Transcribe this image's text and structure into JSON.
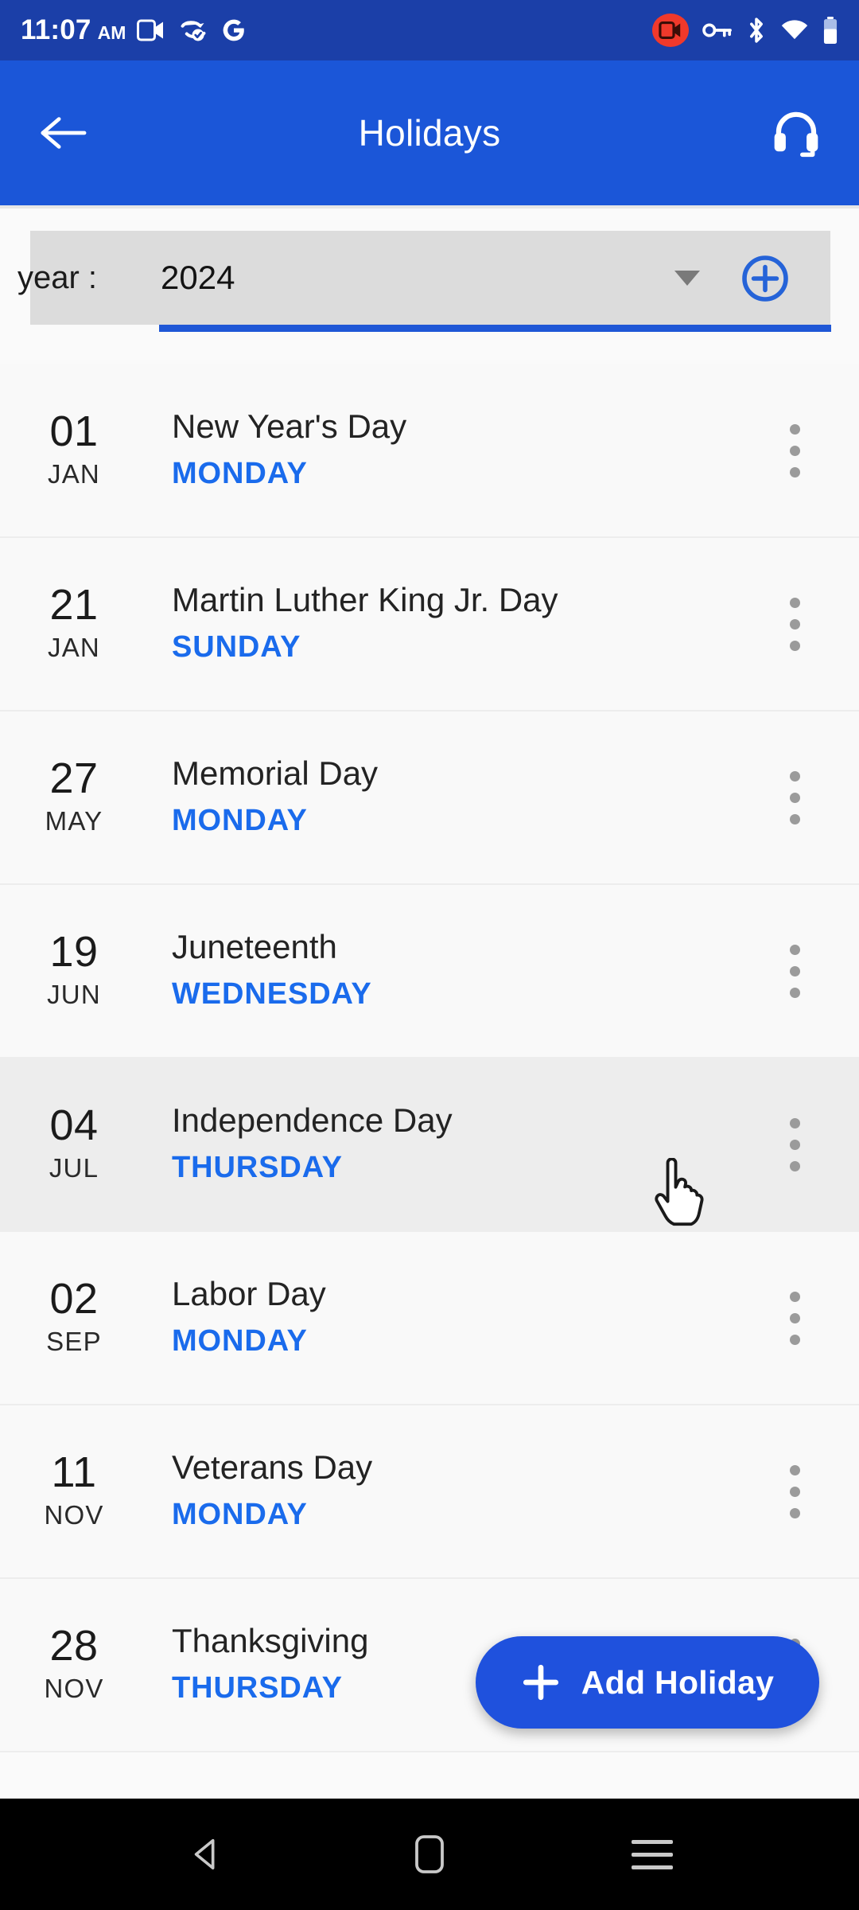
{
  "status_bar": {
    "time": "11:07",
    "ampm": "AM",
    "icons_left": [
      "video-camera-icon",
      "sync-check-icon",
      "google-g-icon"
    ],
    "icons_right": [
      "screen-record-icon",
      "vpn-key-icon",
      "bluetooth-icon",
      "wifi-icon",
      "battery-icon"
    ],
    "background_color": "#1b3fa8"
  },
  "app_bar": {
    "back_label": "back-arrow",
    "title": "Holidays",
    "support_label": "headset-support",
    "background_color": "#1b56d8"
  },
  "year_selector": {
    "label": "year :",
    "value": "2024",
    "caret": "chevron-down-icon",
    "add_label": "add-circle",
    "underline_color": "#1f57d6",
    "field_background": "#dcdcdc"
  },
  "list": {
    "weekday_color": "#1a6bec",
    "holidays": [
      {
        "day": "01",
        "month": "JAN",
        "name": "New Year's Day",
        "weekday": "MONDAY",
        "hovered": false
      },
      {
        "day": "21",
        "month": "JAN",
        "name": "Martin Luther King Jr. Day",
        "weekday": "SUNDAY",
        "hovered": false
      },
      {
        "day": "27",
        "month": "MAY",
        "name": "Memorial Day",
        "weekday": "MONDAY",
        "hovered": false
      },
      {
        "day": "19",
        "month": "JUN",
        "name": "Juneteenth",
        "weekday": "WEDNESDAY",
        "hovered": false
      },
      {
        "day": "04",
        "month": "JUL",
        "name": "Independence Day",
        "weekday": "THURSDAY",
        "hovered": true
      },
      {
        "day": "02",
        "month": "SEP",
        "name": "Labor Day",
        "weekday": "MONDAY",
        "hovered": false
      },
      {
        "day": "11",
        "month": "NOV",
        "name": "Veterans Day",
        "weekday": "MONDAY",
        "hovered": false
      },
      {
        "day": "28",
        "month": "NOV",
        "name": "Thanksgiving",
        "weekday": "THURSDAY",
        "hovered": false
      }
    ],
    "row_menu_label": "more-options"
  },
  "fab": {
    "label": "Add Holiday",
    "icon": "plus-icon",
    "background_color": "#1f51dd"
  },
  "nav_bar": {
    "back": "back-triangle-icon",
    "home": "home-square-icon",
    "recents": "recents-lines-icon"
  }
}
